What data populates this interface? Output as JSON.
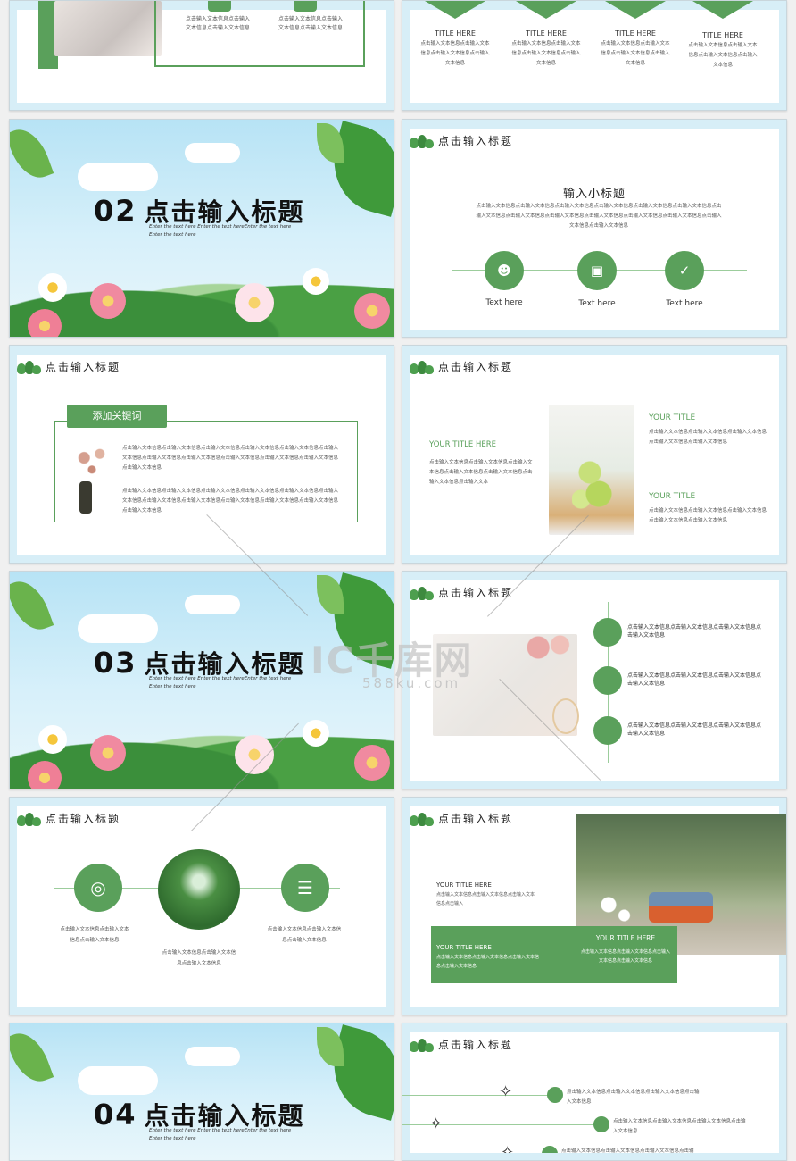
{
  "slide1": {
    "text": "点击输入文本信息点击输入文本信息点击输入文本信息",
    "text2": "点击输入文本信息点击输入文本信息点击输入文本信息"
  },
  "slide2": {
    "items": [
      {
        "title": "TITLE HERE",
        "text": "点击输入文本信息点击输入文本信息点击输入文本信息点击输入文本信息"
      },
      {
        "title": "TITLE HERE",
        "text": "点击输入文本信息点击输入文本信息点击输入文本信息点击输入文本信息"
      },
      {
        "title": "TITLE HERE",
        "text": "点击输入文本信息点击输入文本信息点击输入文本信息点击输入文本信息"
      },
      {
        "title": "TITLE HERE",
        "text": "点击输入文本信息点击输入文本信息点击输入文本信息点击输入文本信息"
      }
    ]
  },
  "section02": {
    "num": "02",
    "title": "点击输入标题",
    "sub1": "Enter the text here Enter the text hereEnter the text here",
    "sub2": "Enter the text here"
  },
  "section03": {
    "num": "03",
    "title": "点击输入标题",
    "sub1": "Enter the text here Enter the text hereEnter the text here",
    "sub2": "Enter the text here"
  },
  "section04": {
    "num": "04",
    "title": "点击输入标题",
    "sub1": "Enter the text here Enter the text hereEnter the text here",
    "sub2": "Enter the text here"
  },
  "header": "点击输入标题",
  "slide4": {
    "subtitle": "输入小标题",
    "text": "点击输入文本信息点击输入文本信息点击输入文本信息点击输入文本信息点击输入文本信息点击输入文本信息点击输入文本信息点击输入文本信息点击输入文本信息点击输入文本信息点击输入文本信息点击输入文本信息点击输入文本信息点击输入文本信息",
    "labels": [
      "Text here",
      "Text here",
      "Text here"
    ]
  },
  "slide5": {
    "tag": "添加关键词",
    "p1": "点击输入文本信息点击输入文本信息点击输入文本信息点击输入文本信息点击输入文本信息点击输入文本信息点击输入文本信息点击输入文本信息点击输入文本信息点击输入文本信息点击输入文本信息点击输入文本信息",
    "p2": "点击输入文本信息点击输入文本信息点击输入文本信息点击输入文本信息点击输入文本信息点击输入文本信息点击输入文本信息点击输入文本信息点击输入文本信息点击输入文本信息点击输入文本信息点击输入文本信息"
  },
  "slide6": {
    "left_title": "YOUR TITLE HERE",
    "left_text": "点击输入文本信息点击输入文本信息点击输入文本信息点击输入文本信息点击输入文本信息点击输入文本信息点击输入文本",
    "r1_title": "YOUR TITLE",
    "r1_text": "点击输入文本信息点击输入文本信息点击输入文本信息点击输入文本信息点击输入文本信息",
    "r2_title": "YOUR TITLE",
    "r2_text": "点击输入文本信息点击输入文本信息点击输入文本信息点击输入文本信息点击输入文本信息"
  },
  "slide8": {
    "items": [
      "点击输入文本信息点击输入文本信息点击输入文本信息点击输入文本信息",
      "点击输入文本信息点击输入文本信息点击输入文本信息点击输入文本信息",
      "点击输入文本信息点击输入文本信息点击输入文本信息点击输入文本信息"
    ]
  },
  "slide9": {
    "t1": "点击输入文本信息点击输入文本信息点击输入文本信息",
    "t2": "点击输入文本信息点击输入文本信息点击输入文本信息",
    "t3": "点击输入文本信息点击输入文本信息点击输入文本信息"
  },
  "slide10": {
    "top_title": "YOUR TITLE HERE",
    "top_text": "点击输入文本信息点击输入文本信息点击输入文本信息点击输入",
    "bl_title": "YOUR TITLE HERE",
    "bl_text": "点击输入文本信息点击输入文本信息点击输入文本信息点击输入文本信息",
    "br_title": "YOUR TITLE HERE",
    "br_text": "点击输入文本信息点击输入文本信息点击输入文本信息点击输入文本信息"
  },
  "slide12": {
    "items": [
      "点击输入文本信息点击输入文本信息点击输入文本信息点击输入文本信息",
      "点击输入文本信息点击输入文本信息点击输入文本信息点击输入文本信息",
      "点击输入文本信息点击输入文本信息点击输入文本信息点击输入文本信息"
    ]
  },
  "watermark": {
    "main": "IC千库网",
    "sub": "588ku.com"
  },
  "colors": {
    "accent": "#5aa05b",
    "sky": "#d7eef7"
  }
}
